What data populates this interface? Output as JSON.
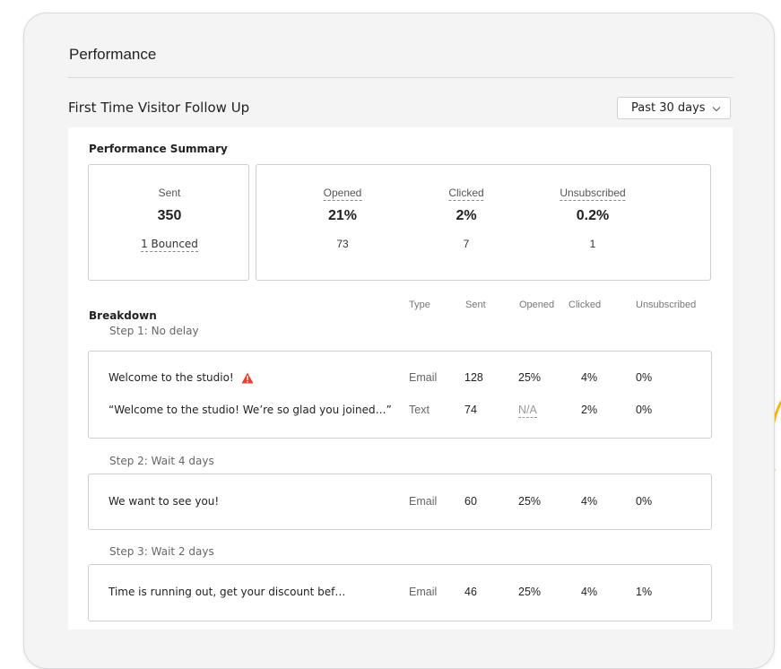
{
  "header": {
    "title": "Performance"
  },
  "campaign": {
    "name": "First Time Visitor Follow Up",
    "range_selected": "Past 30 days"
  },
  "summary": {
    "heading": "Performance Summary",
    "sent": {
      "label": "Sent",
      "value": "350",
      "sub": "1 Bounced"
    },
    "opened": {
      "label": "Opened",
      "value": "21%",
      "count": "73"
    },
    "clicked": {
      "label": "Clicked",
      "value": "2%",
      "count": "7"
    },
    "unsubscribed": {
      "label": "Unsubscribed",
      "value": "0.2%",
      "count": "1"
    }
  },
  "breakdown": {
    "heading": "Breakdown",
    "columns": {
      "type": "Type",
      "sent": "Sent",
      "opened": "Opened",
      "clicked": "Clicked",
      "unsubscribed": "Unsubscribed"
    },
    "steps": [
      {
        "label": "Step 1: No delay",
        "rows": [
          {
            "name": "Welcome to the studio!",
            "type": "Email",
            "sent": "128",
            "opened": "25%",
            "clicked": "4%",
            "unsubscribed": "0%",
            "warning_icon": "warning-triangle-icon"
          },
          {
            "name": "“Welcome to the studio! We’re so glad you joined…”",
            "type": "Text",
            "sent": "74",
            "opened": "N/A",
            "clicked": "2%",
            "unsubscribed": "0%"
          }
        ]
      },
      {
        "label": "Step 2: Wait 4 days",
        "rows": [
          {
            "name": "We want to see you!",
            "type": "Email",
            "sent": "60",
            "opened": "25%",
            "clicked": "4%",
            "unsubscribed": "0%"
          }
        ]
      },
      {
        "label": "Step 3: Wait 2 days",
        "rows": [
          {
            "name": "Time is running out, get your discount bef…",
            "type": "Email",
            "sent": "46",
            "opened": "25%",
            "clicked": "4%",
            "unsubscribed": "1%"
          }
        ]
      }
    ]
  },
  "colors": {
    "warning": "#e8402f",
    "accent_swoosh": "#f2b81f"
  }
}
